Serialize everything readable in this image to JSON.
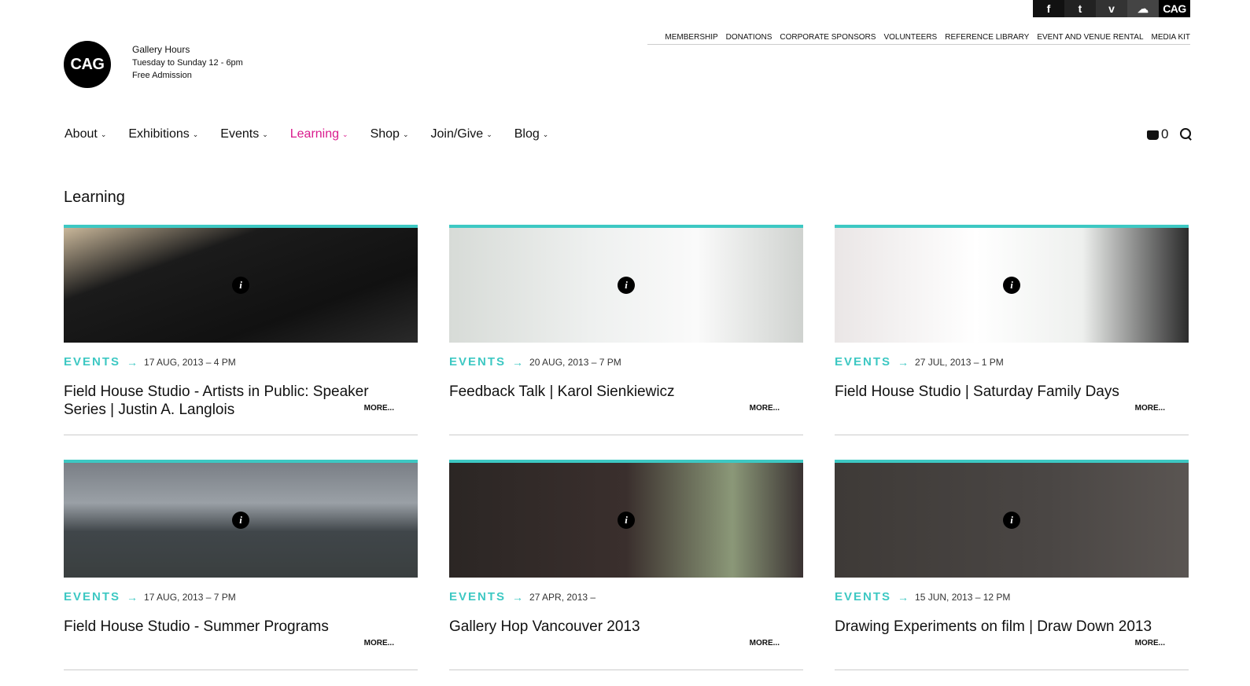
{
  "social": [
    "f",
    "t",
    "v",
    "☁",
    "CAG"
  ],
  "top_links": [
    "MEMBERSHIP",
    "DONATIONS",
    "CORPORATE SPONSORS",
    "VOLUNTEERS",
    "REFERENCE LIBRARY",
    "EVENT AND VENUE RENTAL",
    "MEDIA KIT"
  ],
  "logo": "CAG",
  "hours": {
    "title": "Gallery Hours",
    "line1": "Tuesday to Sunday 12 - 6pm",
    "line2": "Free Admission"
  },
  "nav": [
    "About",
    "Exhibitions",
    "Events",
    "Learning",
    "Shop",
    "Join/Give",
    "Blog"
  ],
  "cart_count": "0",
  "page_title": "Learning",
  "cards": [
    {
      "category": "EVENTS",
      "arrow": "→",
      "date": "17 AUG, 2013 – 4 PM",
      "title": "Field House Studio - Artists in Public: Speaker Series | Justin A. Langlois",
      "more": "MORE...",
      "info": "i"
    },
    {
      "category": "EVENTS",
      "arrow": "→",
      "date": "20 AUG, 2013 – 7 PM",
      "title": "Feedback Talk | Karol Sienkiewicz",
      "more": "MORE...",
      "info": "i"
    },
    {
      "category": "EVENTS",
      "arrow": "→",
      "date": "27 JUL, 2013 – 1 PM",
      "title": "Field House Studio | Saturday Family Days",
      "more": "MORE...",
      "info": "i"
    },
    {
      "category": "EVENTS",
      "arrow": "→",
      "date": "17 AUG, 2013 – 7 PM",
      "title": "Field House Studio - Summer Programs",
      "more": "MORE...",
      "info": "i"
    },
    {
      "category": "EVENTS",
      "arrow": "→",
      "date": "27 APR, 2013 –",
      "title": "Gallery Hop Vancouver 2013",
      "more": "MORE...",
      "info": "i"
    },
    {
      "category": "EVENTS",
      "arrow": "→",
      "date": "15 JUN, 2013 – 12 PM",
      "title": "Drawing Experiments on film | Draw Down 2013",
      "more": "MORE...",
      "info": "i"
    }
  ]
}
